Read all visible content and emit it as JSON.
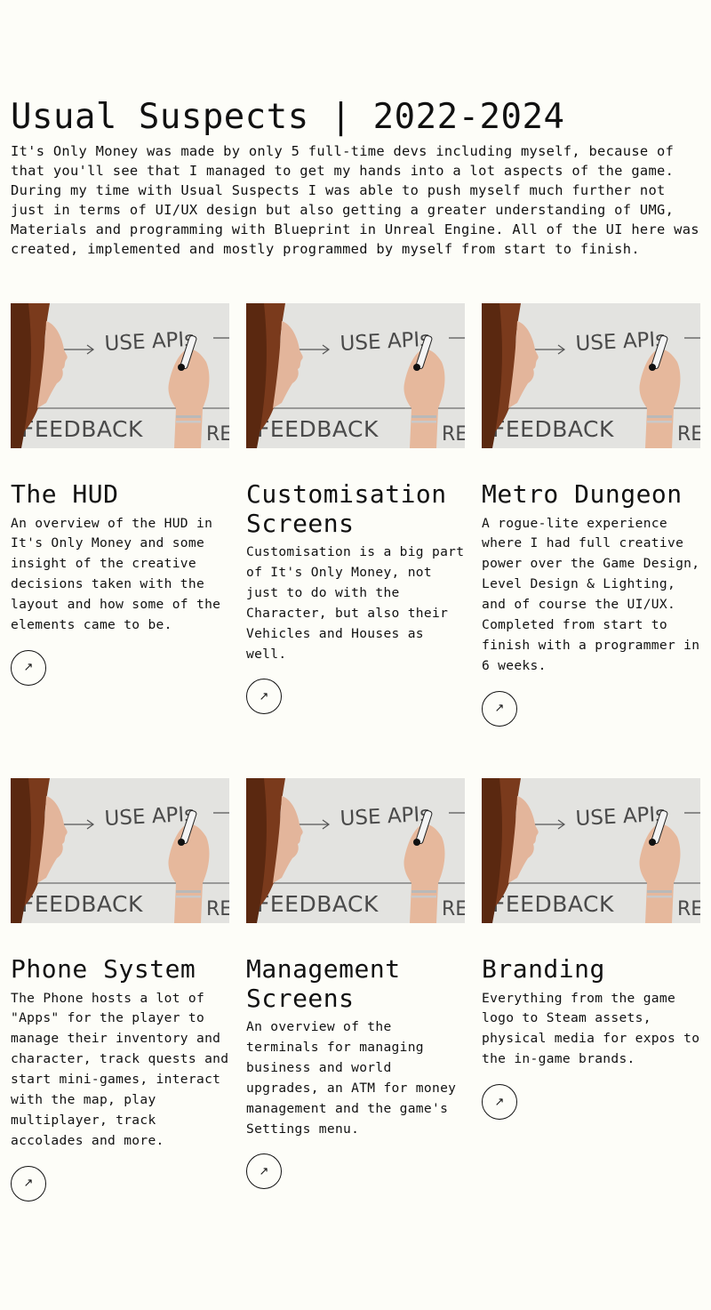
{
  "page": {
    "title": "Usual Suspects | 2022-2024",
    "intro": "It's Only Money was made by only 5 full-time devs including myself, because of that you'll see that I managed to get my hands into a lot aspects of the game. During my time with Usual Suspects I was able to push myself much further not just in terms of UI/UX design but also getting a greater understanding of UMG, Materials and programming with Blueprint in Unreal Engine. All of the UI here was created, implemented and mostly programmed by myself from start to finish."
  },
  "thumbnail": {
    "board_text_top": "USE APIs",
    "board_text_bottom": "FEEDBACK",
    "board_text_right": "RE"
  },
  "projects": [
    {
      "title": "The HUD",
      "description": "An overview of the HUD in It's Only Money and some insight of the creative decisions taken with the layout and how some of the elements came to be.",
      "link_icon": "arrow-up-right-icon"
    },
    {
      "title": "Customisation Screens",
      "description": "Customisation is a big part of It's Only Money, not just to do with the Character, but also their Vehicles and Houses as well.",
      "link_icon": "arrow-up-right-icon"
    },
    {
      "title": "Metro Dungeon",
      "description": "A rogue-lite experience where I had full creative power over the Game Design, Level Design & Lighting, and of course the UI/UX. Completed from start to finish with a programmer in 6 weeks.",
      "link_icon": "arrow-up-right-icon"
    },
    {
      "title": "Phone System",
      "description": "The Phone hosts a lot of \"Apps\" for the player to manage their inventory and character, track quests and start mini-games, interact with the map, play multiplayer, track accolades and more.",
      "link_icon": "arrow-up-right-icon"
    },
    {
      "title": "Management Screens",
      "description": "An overview of the terminals for managing business and world upgrades, an ATM for money management and the game's Settings menu.",
      "link_icon": "arrow-up-right-icon"
    },
    {
      "title": "Branding",
      "description": "Everything from the game logo to Steam assets, physical media for expos to the in-game brands.",
      "link_icon": "arrow-up-right-icon"
    }
  ],
  "colors": {
    "background": "#fdfdf8",
    "text": "#111111",
    "board": "#e6e7e4",
    "hair": "#7a3a1c"
  }
}
